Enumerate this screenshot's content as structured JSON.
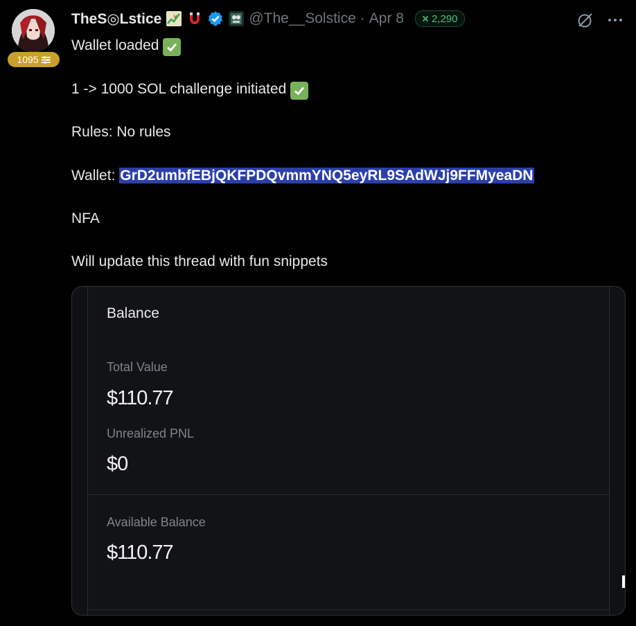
{
  "user": {
    "display_name": "TheS◎Lstice",
    "handle": "@The__Solstice",
    "separator": "·",
    "date": "Apr 8",
    "score_badge": "1095",
    "counter": "2,290",
    "icons": [
      "chart-emoji-icon",
      "magnet-emoji-icon",
      "verified-badge-icon",
      "affiliate-avatar-icon"
    ]
  },
  "tweet": {
    "line1": "Wallet loaded",
    "line2": "1 -> 1000 SOL challenge initiated",
    "line3": "Rules: No rules",
    "wallet_label": "Wallet:",
    "wallet_address": "GrD2umbfEBjQKFPDQvmmYNQ5eyRL9SAdWJj9FFMyeaDN",
    "line5": "NFA",
    "line6": "Will update this thread with fun snippets"
  },
  "balance_card": {
    "title": "Balance",
    "total_value_label": "Total Value",
    "total_value": "$110.77",
    "unrealized_pnl_label": "Unrealized PNL",
    "unrealized_pnl": "$0",
    "available_balance_label": "Available Balance",
    "available_balance": "$110.77"
  },
  "colors": {
    "background": "#000000",
    "text": "#e7e9ea",
    "muted": "#71767b",
    "selection": "#2c3fa8",
    "check_green": "#78b159",
    "verified_blue": "#1d9bf0",
    "badge_gold": "#c9a02a",
    "counter_green": "#4fbf7d"
  }
}
